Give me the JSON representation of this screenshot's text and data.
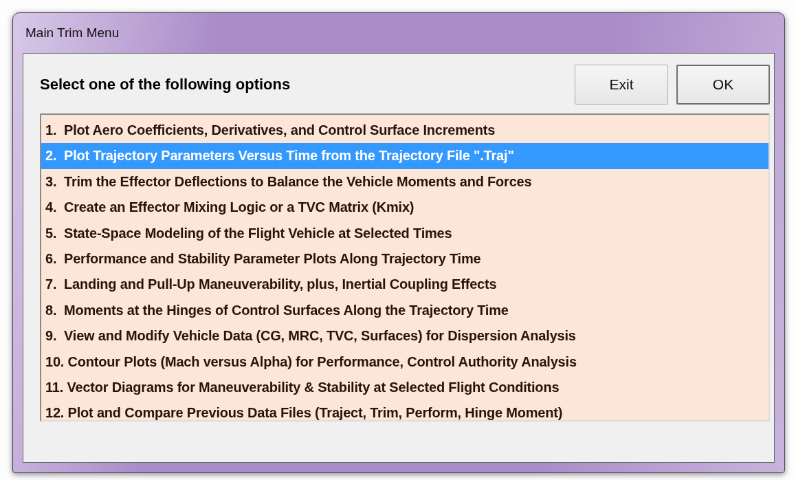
{
  "window": {
    "title": "Main Trim Menu"
  },
  "prompt": "Select one of the following options",
  "buttons": [
    {
      "label": "Exit",
      "default": false
    },
    {
      "label": "OK",
      "default": true
    }
  ],
  "options": [
    {
      "label": "1.  Plot Aero Coefficients, Derivatives, and Control Surface Increments",
      "selected": false
    },
    {
      "label": "2.  Plot Trajectory Parameters Versus Time from the Trajectory File \".Traj\"",
      "selected": true
    },
    {
      "label": "3.  Trim the Effector Deflections to Balance the Vehicle Moments and Forces",
      "selected": false
    },
    {
      "label": "4.  Create an Effector Mixing Logic or a TVC Matrix (Kmix)",
      "selected": false
    },
    {
      "label": "5.  State-Space Modeling of the Flight Vehicle at Selected Times",
      "selected": false
    },
    {
      "label": "6.  Performance and Stability Parameter Plots Along Trajectory Time",
      "selected": false
    },
    {
      "label": "7.  Landing and Pull-Up Maneuverability, plus, Inertial Coupling Effects",
      "selected": false
    },
    {
      "label": "8.  Moments at the Hinges of Control Surfaces Along the Trajectory Time",
      "selected": false
    },
    {
      "label": "9.  View and Modify Vehicle Data (CG, MRC, TVC, Surfaces) for Dispersion Analysis",
      "selected": false
    },
    {
      "label": "10. Contour Plots (Mach versus Alpha) for Performance, Control Authority Analysis",
      "selected": false
    },
    {
      "label": "11. Vector Diagrams for Maneuverability & Stability at Selected Flight Conditions",
      "selected": false
    },
    {
      "label": "12. Plot and Compare Previous Data Files (Traject, Trim, Perform, Hinge Moment)",
      "selected": false
    }
  ]
}
